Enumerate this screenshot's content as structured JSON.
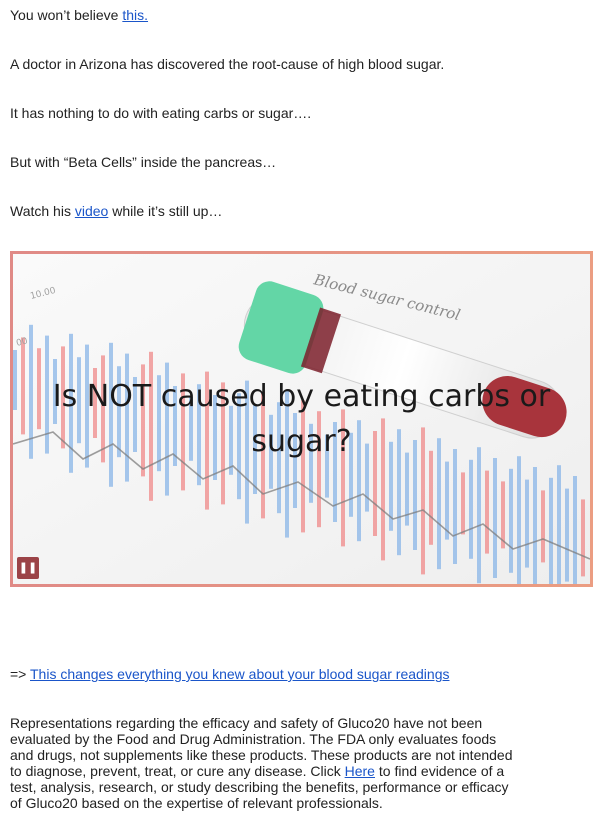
{
  "intro": {
    "text": "You won’t believe ",
    "link": "this."
  },
  "para2": "A doctor in Arizona has discovered the root-cause of high blood sugar.",
  "para3": "It has nothing to do with eating carbs or sugar….",
  "para4": "But with “Beta Cells” inside the pancreas…",
  "para5": {
    "before": "Watch his ",
    "link": "video",
    "after": " while it’s still up…"
  },
  "video": {
    "caption": "Is NOT caused by eating carbs or sugar?",
    "tube_label": "Blood sugar control",
    "scale_labels": [
      "10.00",
      "00"
    ],
    "pause_icon": "pause-icon",
    "pause_symbol": "❚❚"
  },
  "cta": {
    "arrow": "=> ",
    "link": "This changes everything you knew about your blood sugar readings"
  },
  "disclaimer": {
    "before": "Representations regarding the efficacy and safety of Gluco20 have not been evaluated by the Food and Drug Administration. The FDA only evaluates foods and drugs, not supplements like these products. These products are not intended to diagnose, prevent, treat, or cure any disease. Click ",
    "link": "Here",
    "after": " to find evidence of a test, analysis, research, or study describing the benefits, performance or efficacy of Gluco20 based on the expertise of relevant professionals."
  },
  "colors": {
    "link": "#1a55c9",
    "frame_border": "#e8907f",
    "pause_button": "#9b4347",
    "chart_red": "#f08a8a",
    "chart_blue": "#8ab6e8",
    "tube_cap": "#63d6a6"
  }
}
